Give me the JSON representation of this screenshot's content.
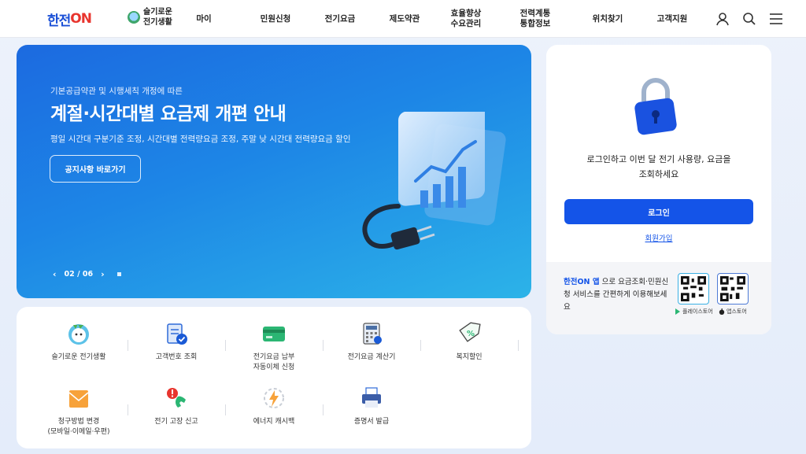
{
  "header": {
    "logo_main": "한전",
    "logo_on": "ON",
    "smart_label": "슬기로운\n전기생활",
    "nav": [
      "마이",
      "민원신청",
      "전기요금",
      "제도약관",
      "효율향상\n수요관리",
      "전력계통\n통합정보",
      "위치찾기",
      "고객지원"
    ],
    "icons": [
      "user-icon",
      "search-icon",
      "menu-icon"
    ]
  },
  "banner": {
    "subtitle": "기본공급약관 및 시행세칙 개정에 따른",
    "title": "계절·시간대별 요금제 개편 안내",
    "description": "평일 시간대 구분기준 조정, 시간대별 전력량요금 조정, 주말 낮 시간대 전력량요금 할인",
    "button": "공지사항 바로가기",
    "page_indicator": "02 / 06",
    "prev_arrow": "‹",
    "next_arrow": "›"
  },
  "services": [
    {
      "label": "슬기로운 전기생활",
      "icon": "mascot-icon"
    },
    {
      "label": "고객번호 조회",
      "icon": "clipboard-check-icon"
    },
    {
      "label": "전기요금 납부\n자동이체 신청",
      "icon": "credit-card-icon"
    },
    {
      "label": "전기요금 계산기",
      "icon": "calculator-icon"
    },
    {
      "label": "복지할인",
      "icon": "discount-tag-icon"
    },
    {
      "label": "청구방법 변경\n(모바일·이메일·우편)",
      "icon": "mail-icon"
    },
    {
      "label": "전기 고장 신고",
      "icon": "phone-alert-icon"
    },
    {
      "label": "에너지 캐시백",
      "icon": "energy-cashback-icon"
    },
    {
      "label": "증명서 발급",
      "icon": "printer-icon"
    }
  ],
  "login": {
    "message_line1": "로그인하고 이번 달 전기 사용량, 요금을",
    "message_line2": "조회하세요",
    "button": "로그인",
    "join": "회원가입",
    "app_brand": "한전ON 앱",
    "app_text": " 으로 요금조회·민원신청 서비스를 간편하게 이용해보세요",
    "google_store": "플레이스토어",
    "apple_store": "앱스토어"
  },
  "colors": {
    "brand_blue": "#1454e8",
    "brand_red": "#e8352e",
    "banner_start": "#1c6ae0",
    "banner_end": "#2cb3e8"
  }
}
